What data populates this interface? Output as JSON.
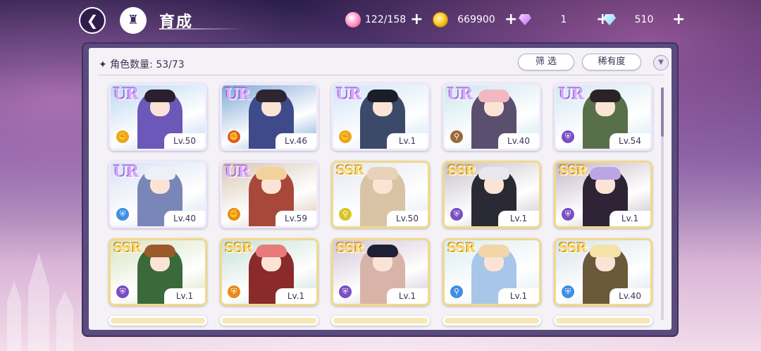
{
  "header": {
    "title": "育成",
    "back_icon": "back-arrow-icon",
    "home_icon": "castle-home-icon"
  },
  "resources": [
    {
      "name": "candy",
      "icon": "candy-icon",
      "value": "122/158"
    },
    {
      "name": "gold",
      "icon": "coin-icon",
      "value": "669900"
    },
    {
      "name": "purple_gem",
      "icon": "purple-gem-icon",
      "value": "1"
    },
    {
      "name": "blue_gem",
      "icon": "blue-gem-icon",
      "value": "510"
    }
  ],
  "plus_label": "+",
  "panel": {
    "count_label": "✦ 角色数量: 53/73",
    "filter_label": "筛 选",
    "sort_label": "稀有度",
    "dropdown_icon": "chevron-down-icon"
  },
  "cards": [
    {
      "rarity": "UR",
      "level": "Lv.50",
      "attr_color": "#f0a41e",
      "attr_icon": "fist-icon",
      "palette": [
        "#bcd7f2",
        "#2a1f2e",
        "#6b58b8"
      ]
    },
    {
      "rarity": "UR",
      "level": "Lv.46",
      "attr_color": "#e05a2a",
      "attr_icon": "fist-icon",
      "palette": [
        "#7fa7d6",
        "#2d2630",
        "#3f4a8a"
      ]
    },
    {
      "rarity": "UR",
      "level": "Lv.1",
      "attr_color": "#f0a41e",
      "attr_icon": "fist-icon",
      "palette": [
        "#cfe4f6",
        "#1c1d2a",
        "#3c4a6a"
      ]
    },
    {
      "rarity": "UR",
      "level": "Lv.40",
      "attr_color": "#9a6a3a",
      "attr_icon": "bat-icon",
      "palette": [
        "#cde6ee",
        "#f2b8c2",
        "#5a4f6e"
      ]
    },
    {
      "rarity": "UR",
      "level": "Lv.54",
      "attr_color": "#7a4fc4",
      "attr_icon": "shield-icon",
      "palette": [
        "#d4e8f2",
        "#2a2326",
        "#58704a"
      ]
    },
    {
      "rarity": "UR",
      "level": "Lv.40",
      "attr_color": "#3f8fe0",
      "attr_icon": "shield-icon",
      "palette": [
        "#d6e2f4",
        "#eef0f8",
        "#7a86b8"
      ]
    },
    {
      "rarity": "UR",
      "level": "Lv.59",
      "attr_color": "#e88a1a",
      "attr_icon": "fist-icon",
      "palette": [
        "#d8c6b2",
        "#f3d19a",
        "#a8483a"
      ]
    },
    {
      "rarity": "SSR",
      "level": "Lv.50",
      "attr_color": "#d8c42a",
      "attr_icon": "bat-icon",
      "palette": [
        "#e4e8f2",
        "#e8d2b8",
        "#d8c4a4"
      ]
    },
    {
      "rarity": "SSR",
      "level": "Lv.1",
      "attr_color": "#7a4fc4",
      "attr_icon": "shield-icon",
      "palette": [
        "#c8c2cc",
        "#e8e8ee",
        "#2a2a34"
      ]
    },
    {
      "rarity": "SSR",
      "level": "Lv.1",
      "attr_color": "#7a4fc4",
      "attr_icon": "shield-icon",
      "palette": [
        "#c6b8c6",
        "#b9a6e2",
        "#2e2436"
      ]
    },
    {
      "rarity": "SSR",
      "level": "Lv.1",
      "attr_color": "#7a4fc4",
      "attr_icon": "shield-icon",
      "palette": [
        "#d8e4c2",
        "#9a5a2a",
        "#3a6a3a"
      ]
    },
    {
      "rarity": "SSR",
      "level": "Lv.1",
      "attr_color": "#e88a1a",
      "attr_icon": "shield-icon",
      "palette": [
        "#c6e0d8",
        "#e87a7a",
        "#8a2a2a"
      ]
    },
    {
      "rarity": "SSR",
      "level": "Lv.1",
      "attr_color": "#7a4fc4",
      "attr_icon": "shield-icon",
      "palette": [
        "#d2c4d6",
        "#1e1e36",
        "#d8b4a8"
      ]
    },
    {
      "rarity": "SSR",
      "level": "Lv.1",
      "attr_color": "#3f8fe0",
      "attr_icon": "bat-icon",
      "palette": [
        "#dcecf4",
        "#f2d6a8",
        "#a8c6e8"
      ]
    },
    {
      "rarity": "SSR",
      "level": "Lv.40",
      "attr_color": "#3f8fe0",
      "attr_icon": "shield-icon",
      "palette": [
        "#d8e4ec",
        "#f4e2a8",
        "#6a5a3a"
      ]
    }
  ]
}
